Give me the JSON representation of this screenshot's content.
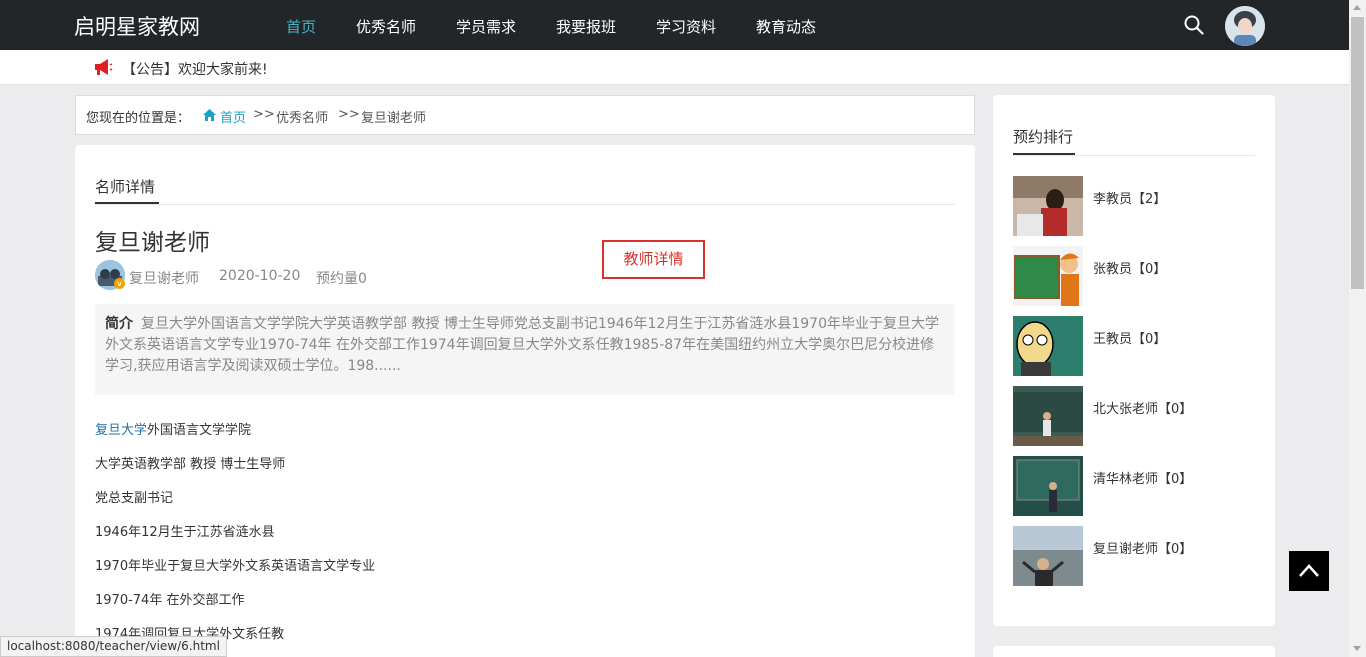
{
  "nav": {
    "brand": "启明星家教网",
    "items": [
      {
        "label": "首页",
        "active": true
      },
      {
        "label": "优秀名师"
      },
      {
        "label": "学员需求"
      },
      {
        "label": "我要报班"
      },
      {
        "label": "学习资料"
      },
      {
        "label": "教育动态"
      }
    ]
  },
  "announcement": {
    "text": "【公告】欢迎大家前来!"
  },
  "breadcrumb": {
    "label": "您现在的位置是：",
    "home": "首页",
    "sep": ">>",
    "middle": "优秀名师",
    "current": "复旦谢老师"
  },
  "main": {
    "section_title": "名师详情",
    "teacher_name": "复旦谢老师",
    "meta_author": "复旦谢老师",
    "meta_date": "2020-10-20",
    "meta_bookings": "预约量0",
    "badge": "v",
    "detail_button": "教师详情",
    "intro_label": "简介",
    "intro_text": "复旦大学外国语言文学学院大学英语教学部 教授 博士生导师党总支副书记1946年12月生于江苏省涟水县1970年毕业于复旦大学外文系英语语言文学专业1970-74年 在外交部工作1974年调回复旦大学外文系任教1985-87年在美国纽约州立大学奥尔巴尼分校进修学习,获应用语言学及阅读双硕士学位。198......",
    "para_link": "复旦大学",
    "para_link_rest": "外国语言文学学院",
    "paragraphs": [
      "大学英语教学部 教授 博士生导师",
      "党总支副书记",
      "1946年12月生于江苏省涟水县",
      "1970年毕业于复旦大学外文系英语语言文学专业",
      "1970-74年 在外交部工作",
      "1974年调回复旦大学外文系任教"
    ]
  },
  "sidebar": {
    "title": "预约排行",
    "items": [
      {
        "label": "李教员【2】"
      },
      {
        "label": "张教员【0】"
      },
      {
        "label": "王教员【0】"
      },
      {
        "label": "北大张老师【0】"
      },
      {
        "label": "清华林老师【0】"
      },
      {
        "label": "复旦谢老师【0】"
      }
    ]
  },
  "statusbar": {
    "url": "localhost:8080/teacher/view/6.html"
  }
}
